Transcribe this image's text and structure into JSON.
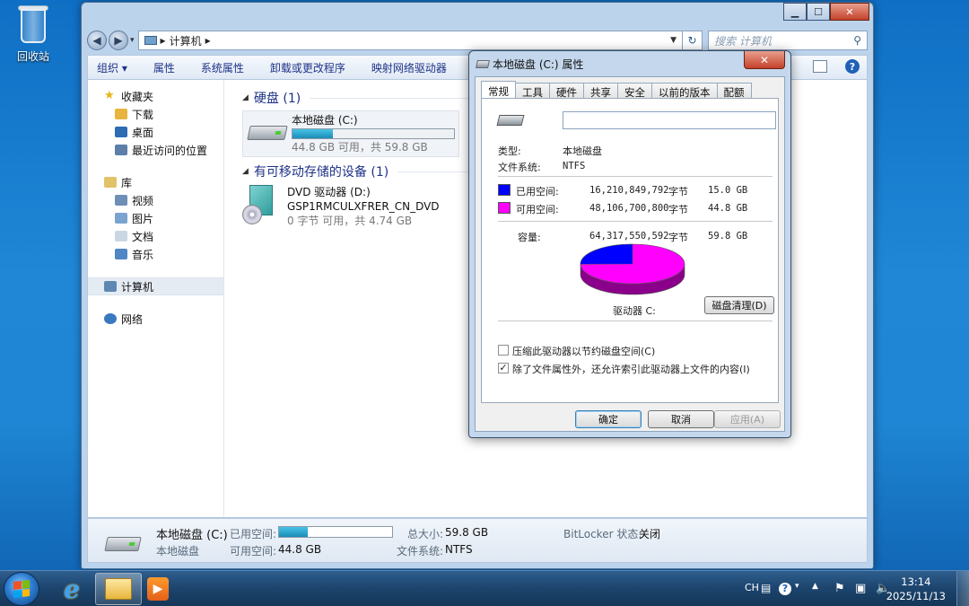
{
  "desktop": {
    "recycle_bin_label": "回收站"
  },
  "explorer": {
    "address": {
      "crumb": "计算机",
      "sep": "▸"
    },
    "search_placeholder": "搜索 计算机",
    "toolbar": [
      "组织 ▾",
      "属性",
      "系统属性",
      "卸载或更改程序",
      "映射网络驱动器"
    ],
    "nav": {
      "favorites": "收藏夹",
      "fav_items": [
        "下载",
        "桌面",
        "最近访问的位置"
      ],
      "libraries": "库",
      "lib_items": [
        "视频",
        "图片",
        "文档",
        "音乐"
      ],
      "computer": "计算机",
      "network": "网络"
    },
    "groups": {
      "hdd": "硬盘 (1)",
      "removable": "有可移动存储的设备 (1)"
    },
    "drive_c": {
      "name": "本地磁盘 (C:)",
      "free_text": "44.8 GB 可用，共 59.8 GB",
      "used_fraction": 0.25
    },
    "drive_d": {
      "name": "DVD 驱动器 (D:)",
      "label": "GSP1RMCULXFRER_CN_DVD",
      "free_text": "0 字节 可用，共 4.74 GB"
    },
    "details": {
      "name": "本地磁盘 (C:)",
      "type": "本地磁盘",
      "used_label": "已用空间:",
      "free_label": "可用空间:",
      "free_value": "44.8 GB",
      "total_label": "总大小:",
      "total_value": "59.8 GB",
      "fs_label": "文件系统:",
      "fs_value": "NTFS",
      "bitlocker_label": "BitLocker 状态:",
      "bitlocker_value": "关闭",
      "used_fraction": 0.25
    }
  },
  "props": {
    "title": "本地磁盘 (C:) 属性",
    "close": "✕",
    "tabs": [
      "常规",
      "工具",
      "硬件",
      "共享",
      "安全",
      "以前的版本",
      "配额"
    ],
    "active_tab": 0,
    "name_value": "",
    "type_label": "类型:",
    "type_value": "本地磁盘",
    "fs_label": "文件系统:",
    "fs_value": "NTFS",
    "used_label": "已用空间:",
    "used_bytes": "16,210,849,792",
    "used_unit": "字节",
    "used_gb": "15.0 GB",
    "free_label": "可用空间:",
    "free_bytes": "48,106,700,800",
    "free_unit": "字节",
    "free_gb": "44.8 GB",
    "cap_label": "容量:",
    "cap_bytes": "64,317,550,592",
    "cap_unit": "字节",
    "cap_gb": "59.8 GB",
    "drive_label": "驱动器 C:",
    "cleanup_btn": "磁盘清理(D)",
    "compress_label": "压缩此驱动器以节约磁盘空间(C)",
    "compress_checked": false,
    "index_label": "除了文件属性外，还允许索引此驱动器上文件的内容(I)",
    "index_checked": true,
    "ok": "确定",
    "cancel": "取消",
    "apply": "应用(A)",
    "used_color": "#0000ff",
    "free_color": "#ff00ff",
    "used_fraction": 0.252
  },
  "taskbar": {
    "lang": "CH",
    "time": "13:14",
    "date": "2025/11/13"
  }
}
